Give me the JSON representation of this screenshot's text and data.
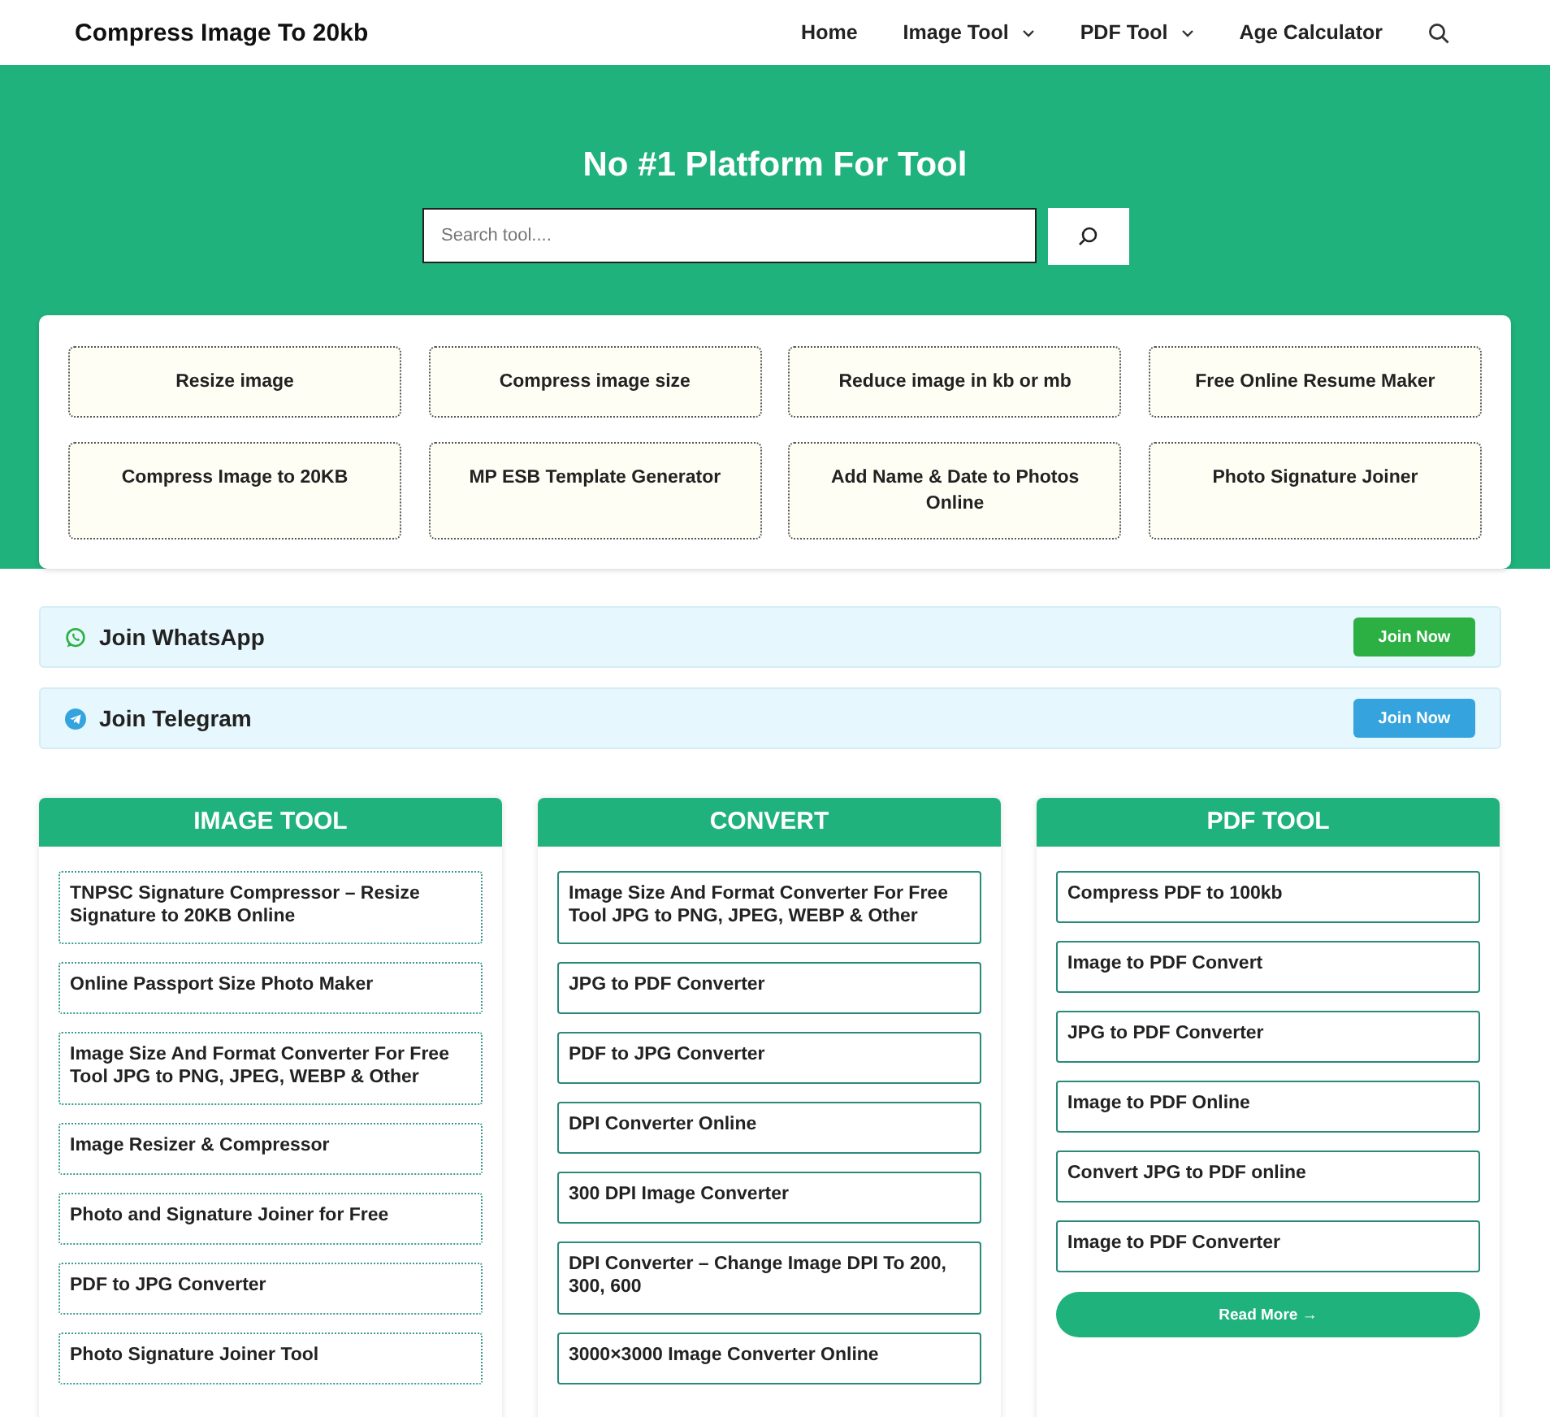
{
  "header": {
    "site_title": "Compress Image To 20kb",
    "nav": [
      {
        "label": "Home",
        "dropdown": false
      },
      {
        "label": "Image Tool",
        "dropdown": true
      },
      {
        "label": "PDF Tool",
        "dropdown": true
      },
      {
        "label": "Age Calculator",
        "dropdown": false
      }
    ]
  },
  "hero": {
    "title": "No #1 Platform For Tool",
    "search": {
      "placeholder": "Search tool...."
    }
  },
  "quick_tools": [
    "Resize image",
    "Compress image size",
    "Reduce image in kb or mb",
    "Free Online Resume Maker",
    "Compress Image to 20KB",
    "MP ESB Template Generator",
    "Add Name & Date to Photos Online",
    "Photo Signature Joiner"
  ],
  "join_bars": [
    {
      "kind": "whatsapp",
      "label": "Join WhatsApp",
      "button": "Join Now",
      "color": "#2db043"
    },
    {
      "kind": "telegram",
      "label": "Join Telegram",
      "button": "Join Now",
      "color": "#35a4de"
    }
  ],
  "columns": [
    {
      "title": "IMAGE TOOL",
      "kind": "dotted",
      "links": [
        "TNPSC Signature Compressor – Resize Signature to 20KB Online",
        "Online Passport Size Photo Maker",
        "Image Size And Format Converter For Free Tool JPG to PNG, JPEG, WEBP & Other",
        "Image Resizer & Compressor",
        "Photo and Signature Joiner for Free",
        "PDF to JPG Converter",
        "Photo Signature Joiner Tool"
      ]
    },
    {
      "title": "CONVERT",
      "kind": "solid",
      "links": [
        "Image Size And Format Converter For Free Tool JPG to PNG, JPEG, WEBP & Other",
        "JPG to PDF Converter",
        "PDF to JPG Converter",
        "DPI Converter Online",
        "300 DPI Image Converter",
        "DPI Converter – Change Image DPI To 200, 300, 600",
        "3000×3000 Image Converter Online"
      ]
    },
    {
      "title": "PDF TOOL",
      "kind": "solid",
      "links": [
        "Compress PDF to 100kb",
        "Image to PDF Convert",
        "JPG to PDF Converter",
        "Image to PDF Online",
        "Convert JPG to PDF online",
        "Image to PDF Converter"
      ],
      "read_more": "Read More →"
    }
  ]
}
